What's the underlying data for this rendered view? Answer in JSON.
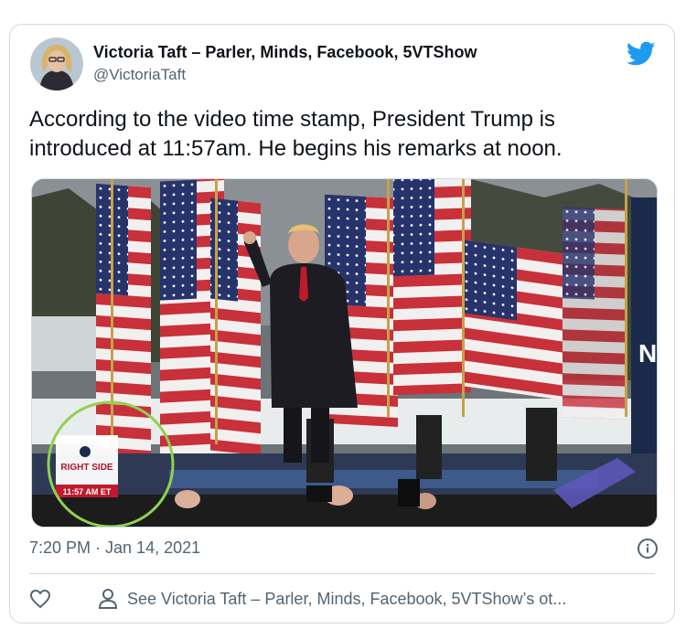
{
  "tweet": {
    "author_name": "Victoria Taft – Parler, Minds, Facebook, 5VTShow",
    "author_handle": "@VictoriaTaft",
    "text": "According to the video time stamp, President Trump is introduced at 11:57am. He begins his remarks at noon.",
    "timestamp": "7:20 PM · Jan 14, 2021"
  },
  "media": {
    "logo_line1": "RIGHT SIDE",
    "logo_line2": "11:57 AM ET",
    "highlight_color": "#8fd14f"
  },
  "actions": {
    "see_profile_label": "See Victoria Taft – Parler, Minds, Facebook, 5VTShow’s ot..."
  },
  "colors": {
    "twitter_blue": "#1d9bf0",
    "secondary_text": "#536471",
    "border": "#cfd9de"
  },
  "icons": [
    "twitter-bird-icon",
    "info-icon",
    "heart-icon",
    "person-icon"
  ]
}
